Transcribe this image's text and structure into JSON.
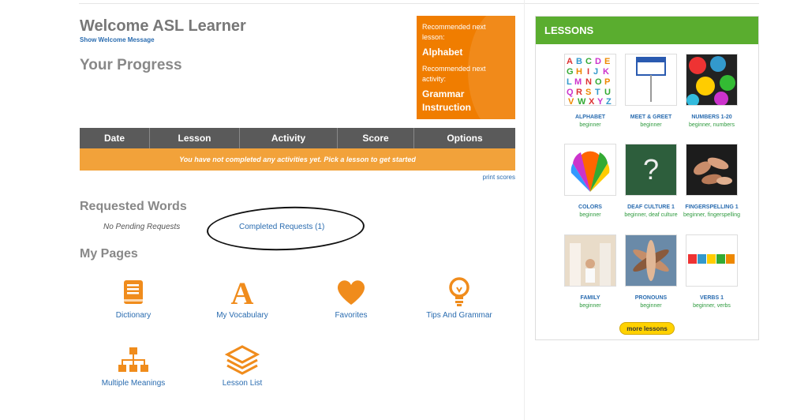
{
  "header": {
    "welcome": "Welcome ASL Learner",
    "show_welcome": "Show Welcome Message",
    "progress_title": "Your Progress"
  },
  "recommended": {
    "lesson_label": "Recommended next lesson:",
    "lesson_value": "Alphabet",
    "activity_label": "Recommended next activity:",
    "activity_value": "Grammar Instruction"
  },
  "progress_table": {
    "columns": [
      "Date",
      "Lesson",
      "Activity",
      "Score",
      "Options"
    ],
    "empty_message": "You have not completed any activities yet. Pick a lesson to get started",
    "print_link": "print scores"
  },
  "requested_words": {
    "title": "Requested Words",
    "pending": "No Pending Requests",
    "completed": "Completed Requests (1)"
  },
  "my_pages": {
    "title": "My Pages",
    "items": [
      {
        "label": "Dictionary",
        "icon": "book-icon"
      },
      {
        "label": "My Vocabulary",
        "icon": "letter-a-icon"
      },
      {
        "label": "Favorites",
        "icon": "heart-icon"
      },
      {
        "label": "Tips And Grammar",
        "icon": "lightbulb-icon"
      },
      {
        "label": "Multiple Meanings",
        "icon": "hierarchy-icon"
      },
      {
        "label": "Lesson List",
        "icon": "layers-icon"
      }
    ]
  },
  "lessons": {
    "title": "LESSONS",
    "items": [
      {
        "name": "ALPHABET",
        "level": "beginner"
      },
      {
        "name": "MEET & GREET",
        "level": "beginner"
      },
      {
        "name": "NUMBERS 1-20",
        "level": "beginner, numbers"
      },
      {
        "name": "COLORS",
        "level": "beginner"
      },
      {
        "name": "DEAF CULTURE 1",
        "level": "beginner, deaf culture"
      },
      {
        "name": "FINGERSPELLING 1",
        "level": "beginner, fingerspelling"
      },
      {
        "name": "FAMILY",
        "level": "beginner"
      },
      {
        "name": "PRONOUNS",
        "level": "beginner"
      },
      {
        "name": "VERBS 1",
        "level": "beginner, verbs"
      }
    ],
    "more": "more lessons"
  },
  "colors": {
    "accent_orange": "#f07d00",
    "lessons_green": "#5aad2f",
    "link_blue": "#2a6cb0"
  }
}
